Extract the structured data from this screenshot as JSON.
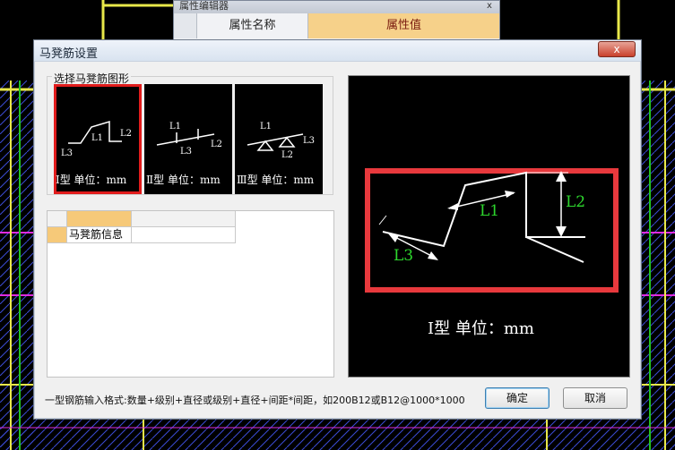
{
  "background_window": {
    "title": "属性编辑器",
    "close_label": "x",
    "columns": [
      "属性名称",
      "属性值"
    ]
  },
  "dialog": {
    "title": "马凳筋设置",
    "close_label": "x",
    "group_label": "选择马凳筋图形",
    "shapes": [
      {
        "id": "type1",
        "caption": "Ⅰ型 单位：mm",
        "labels": [
          "L1",
          "L2",
          "L3"
        ],
        "selected": true
      },
      {
        "id": "type2",
        "caption": "Ⅱ型 单位：mm",
        "labels": [
          "L1",
          "L2",
          "L3"
        ],
        "selected": false
      },
      {
        "id": "type3",
        "caption": "Ⅲ型 单位：mm",
        "labels": [
          "L1",
          "L2",
          "L3"
        ],
        "selected": false
      }
    ],
    "table": {
      "row_label": "马凳筋信息",
      "row_value": ""
    },
    "preview": {
      "caption": "Ⅰ型 单位：mm",
      "labels": {
        "l1": "L1",
        "l2": "L2",
        "l3": "L3"
      },
      "frame_color": "#e8393d",
      "label_color": "#2dd62d"
    },
    "hint": "一型钢筋输入格式:数量+级别+直径或级别+直径+间距*间距，如200B12或B12@1000*1000",
    "ok_label": "确定",
    "cancel_label": "取消"
  }
}
